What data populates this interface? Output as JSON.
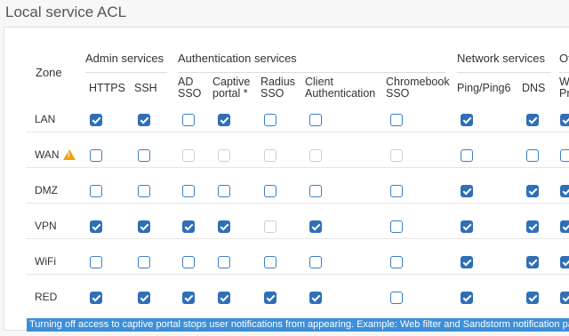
{
  "title": "Local service ACL",
  "zone_header": "Zone",
  "groups": {
    "admin": "Admin services",
    "auth": "Authentication services",
    "network": "Network services",
    "other": "Ot"
  },
  "columns": [
    {
      "key": "https",
      "label": "HTTPS"
    },
    {
      "key": "ssh",
      "label": "SSH"
    },
    {
      "key": "ad_sso",
      "label1": "AD",
      "label2": "SSO"
    },
    {
      "key": "captive",
      "label1": "Captive",
      "label2": "portal *"
    },
    {
      "key": "radius",
      "label1": "Radius",
      "label2": "SSO"
    },
    {
      "key": "client_auth",
      "label1": "Client",
      "label2": "Authentication"
    },
    {
      "key": "chromebook",
      "label1": "Chromebook",
      "label2": "SSO"
    },
    {
      "key": "ping",
      "label": "Ping/Ping6"
    },
    {
      "key": "dns",
      "label": "DNS"
    },
    {
      "key": "other",
      "label1": "W",
      "label2": "Pr"
    }
  ],
  "rows": [
    {
      "zone": "LAN",
      "warning": false,
      "states": [
        "on",
        "on",
        "off",
        "on",
        "off",
        "off",
        "off",
        "on",
        "on",
        "on"
      ]
    },
    {
      "zone": "WAN",
      "warning": true,
      "states": [
        "off",
        "off",
        "dis",
        "dis",
        "dis",
        "dis",
        "dis",
        "off",
        "off",
        "off"
      ]
    },
    {
      "zone": "DMZ",
      "warning": false,
      "states": [
        "off",
        "off",
        "off",
        "off",
        "off",
        "off",
        "off",
        "on",
        "on",
        "on"
      ]
    },
    {
      "zone": "VPN",
      "warning": false,
      "states": [
        "on",
        "on",
        "on",
        "on",
        "dis",
        "on",
        "off",
        "on",
        "on",
        "on"
      ]
    },
    {
      "zone": "WiFi",
      "warning": false,
      "states": [
        "off",
        "off",
        "off",
        "off",
        "off",
        "off",
        "off",
        "on",
        "on",
        "on"
      ]
    },
    {
      "zone": "RED",
      "warning": false,
      "states": [
        "on",
        "on",
        "on",
        "on",
        "on",
        "on",
        "off",
        "on",
        "on",
        "on"
      ]
    }
  ],
  "note": "Turning off access to captive portal stops user notifications from appearing. Example: Web filter and Sandstorm notification pages"
}
